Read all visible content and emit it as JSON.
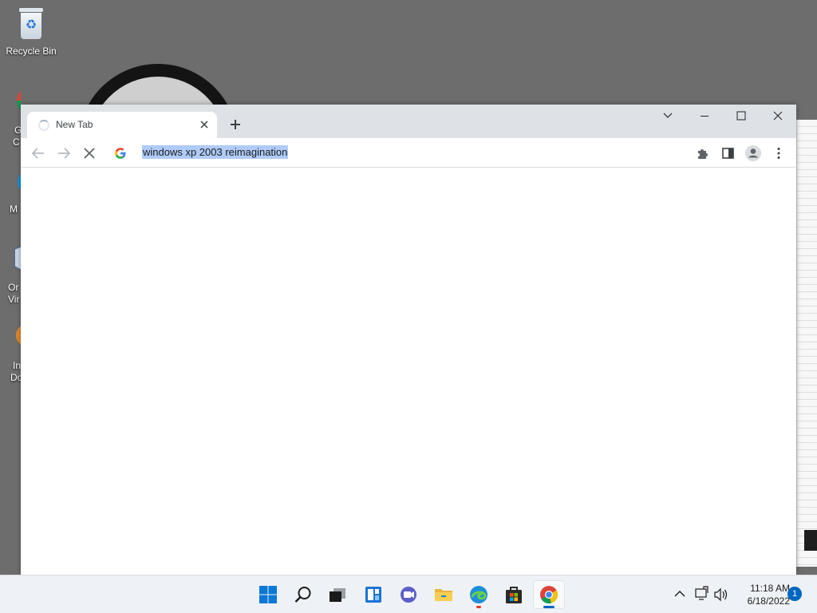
{
  "desktop": {
    "icons": [
      {
        "label": "Recycle Bin"
      }
    ],
    "partial_labels": [
      "G",
      "C",
      "M",
      "Or",
      "Vir",
      "In",
      "Do"
    ]
  },
  "browser": {
    "tab": {
      "title": "New Tab",
      "loading": true
    },
    "omnibox": {
      "text": "windows xp 2003 reimagination",
      "selected": true
    },
    "window_controls": [
      "tab-search",
      "minimize",
      "maximize",
      "close"
    ],
    "toolbar_icons": [
      "back-icon",
      "forward-icon",
      "stop-icon",
      "google-icon",
      "extensions-icon",
      "side-panel-icon",
      "profile-icon",
      "menu-icon"
    ]
  },
  "taskbar": {
    "apps": [
      "start",
      "search",
      "task-view",
      "widgets",
      "chat",
      "file-explorer",
      "edge",
      "store",
      "chrome"
    ],
    "active_app": "chrome",
    "clock": {
      "time": "11:18 AM",
      "date": "6/18/2022"
    },
    "notifications": "1"
  },
  "colors": {
    "accent": "#0067c0",
    "selection": "#aecbfa",
    "titlebar": "#dee1e6"
  }
}
